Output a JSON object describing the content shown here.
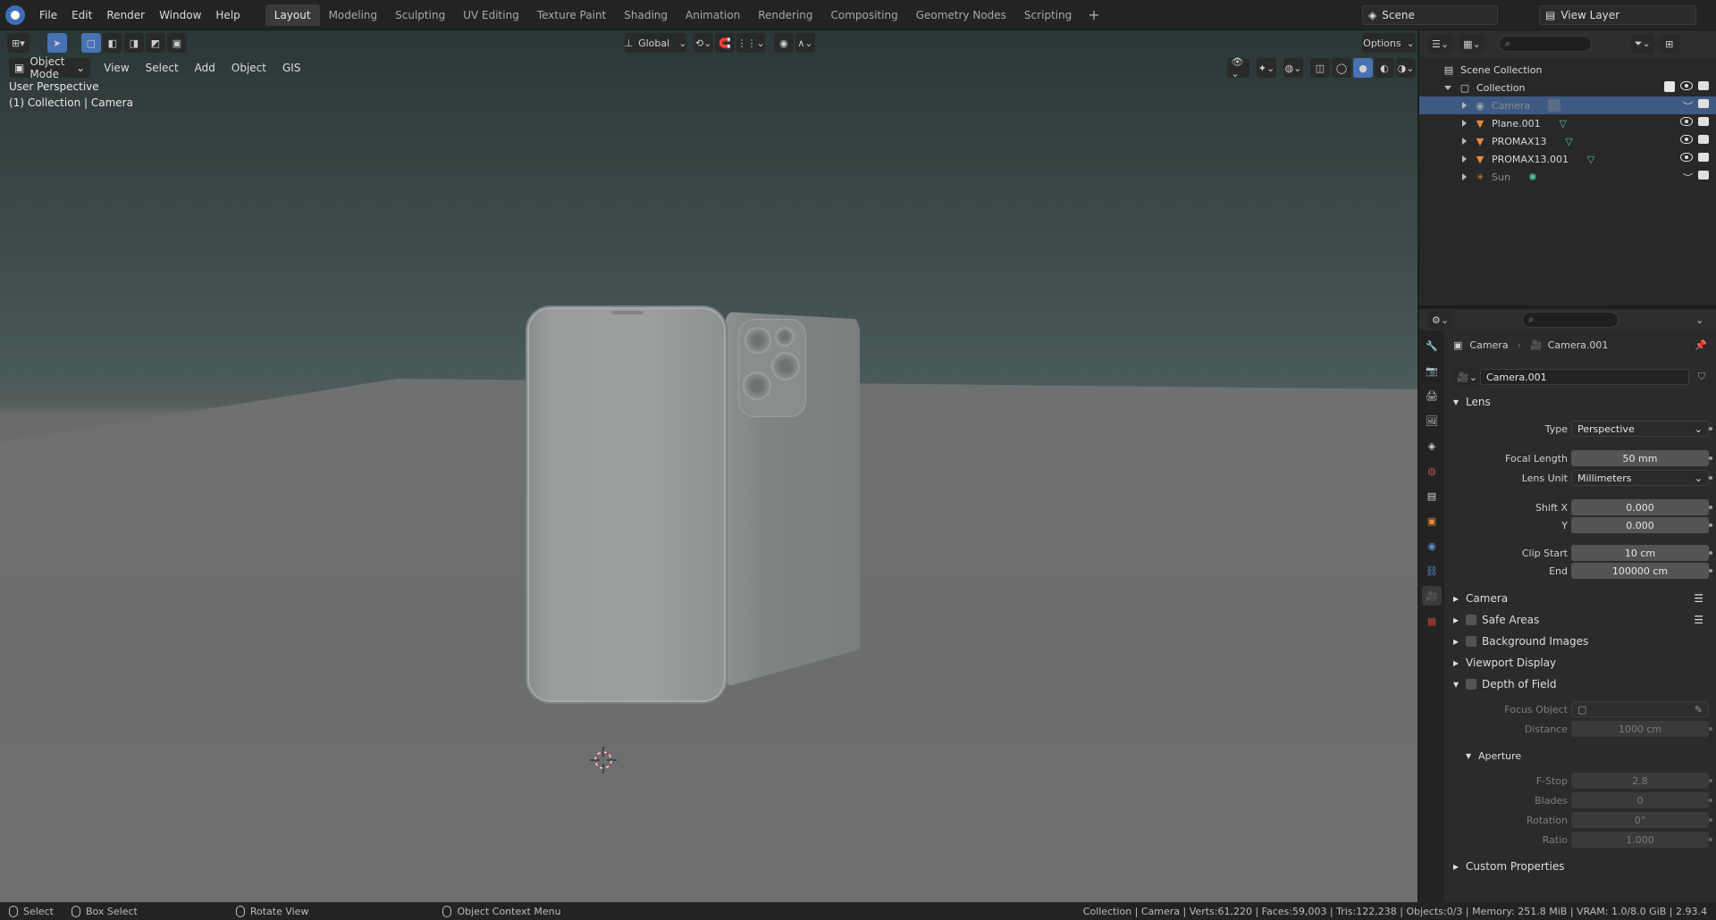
{
  "menubar": {
    "items": [
      "File",
      "Edit",
      "Render",
      "Window",
      "Help"
    ],
    "workspaces": [
      "Layout",
      "Modeling",
      "Sculpting",
      "UV Editing",
      "Texture Paint",
      "Shading",
      "Animation",
      "Rendering",
      "Compositing",
      "Geometry Nodes",
      "Scripting"
    ],
    "active_workspace": "Layout",
    "scene": "Scene",
    "view_layer": "View Layer"
  },
  "viewport": {
    "transform_orientation": "Global",
    "options_label": "Options",
    "mode": "Object Mode",
    "menus": [
      "View",
      "Select",
      "Add",
      "Object",
      "GIS"
    ],
    "view_name": "User Perspective",
    "context": "(1) Collection | Camera"
  },
  "outliner": {
    "scene_collection": "Scene Collection",
    "collection": "Collection",
    "objects": [
      {
        "name": "Camera",
        "selected": true,
        "muted": true
      },
      {
        "name": "Plane.001",
        "selected": false,
        "muted": false
      },
      {
        "name": "PROMAX13",
        "selected": false,
        "muted": false
      },
      {
        "name": "PROMAX13.001",
        "selected": false,
        "muted": false
      },
      {
        "name": "Sun",
        "selected": false,
        "muted": true
      }
    ]
  },
  "properties": {
    "breadcrumb_object": "Camera",
    "breadcrumb_data": "Camera.001",
    "data_name": "Camera.001",
    "lens": {
      "title": "Lens",
      "type_label": "Type",
      "type_value": "Perspective",
      "focal_length_label": "Focal Length",
      "focal_length": "50 mm",
      "lens_unit_label": "Lens Unit",
      "lens_unit": "Millimeters",
      "shift_x_label": "Shift X",
      "shift_x": "0.000",
      "shift_y_label": "Y",
      "shift_y": "0.000",
      "clip_start_label": "Clip Start",
      "clip_start": "10 cm",
      "clip_end_label": "End",
      "clip_end": "100000 cm"
    },
    "panels": {
      "camera": "Camera",
      "safe_areas": "Safe Areas",
      "background_images": "Background Images",
      "viewport_display": "Viewport Display",
      "depth_of_field": "Depth of Field",
      "custom_properties": "Custom Properties"
    },
    "dof": {
      "focus_object_label": "Focus Object",
      "distance_label": "Distance",
      "distance": "1000 cm",
      "aperture_title": "Aperture",
      "fstop_label": "F-Stop",
      "fstop": "2.8",
      "blades_label": "Blades",
      "blades": "0",
      "rotation_label": "Rotation",
      "rotation": "0°",
      "ratio_label": "Ratio",
      "ratio": "1.000"
    }
  },
  "statusbar": {
    "select": "Select",
    "box_select": "Box Select",
    "rotate_view": "Rotate View",
    "context_menu": "Object Context Menu",
    "stats": "Collection | Camera | Verts:61,220 | Faces:59,003 | Tris:122,238 | Objects:0/3 | Memory: 251.8 MiB | VRAM: 1.0/8.0 GiB | 2.93.4"
  },
  "colors": {
    "accent": "#4772b3",
    "selected_row": "#3f5a82",
    "mesh_icon": "#e8893a",
    "data_icon": "#4fc3a1"
  }
}
